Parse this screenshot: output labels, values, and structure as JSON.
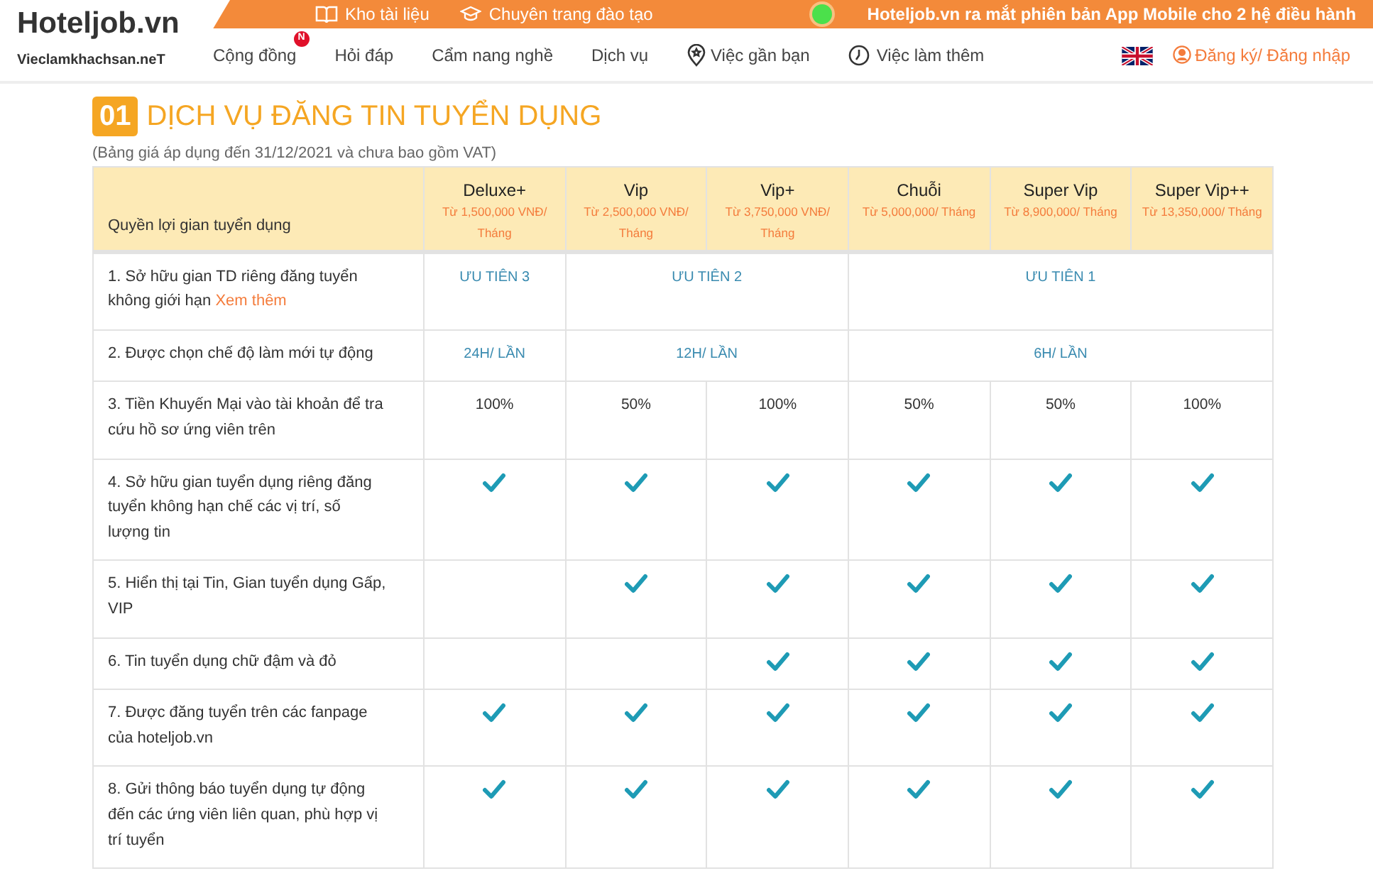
{
  "logo": {
    "name": "Hoteljob.vn",
    "tagline": "Vieclamkhachsan.neT"
  },
  "top_bar": {
    "links": [
      {
        "label": "Kho tài liệu",
        "kind": "book"
      },
      {
        "label": "Chuyên trang đào tạo",
        "kind": "cap"
      }
    ],
    "announcement": "Hoteljob.vn ra mắt phiên bản App Mobile cho 2 hệ điều hành"
  },
  "nav": [
    {
      "label": "Cộng đồng",
      "badge": "N"
    },
    {
      "label": "Hỏi đáp"
    },
    {
      "label": "Cẩm nang nghề"
    },
    {
      "label": "Dịch vụ"
    },
    {
      "label": "Việc gần bạn",
      "kind": "pin"
    },
    {
      "label": "Việc làm thêm",
      "kind": "clock"
    }
  ],
  "account": {
    "label": "Đăng ký/ Đăng nhập"
  },
  "section": {
    "number": "01",
    "title": "DỊCH VỤ ĐĂNG TIN TUYỂN DỤNG",
    "note": "(Bảng giá áp dụng đến 31/12/2021 và chưa bao gồm VAT)"
  },
  "table": {
    "corner": "Quyền lợi gian tuyển dụng",
    "columns": [
      {
        "name": "Deluxe+",
        "price": "Từ 1,500,000 VNĐ/ Tháng"
      },
      {
        "name": "Vip",
        "price": "Từ 2,500,000 VNĐ/ Tháng"
      },
      {
        "name": "Vip+",
        "price": "Từ 3,750,000 VNĐ/ Tháng"
      },
      {
        "name": "Chuỗi",
        "price": "Từ 5,000,000/ Tháng"
      },
      {
        "name": "Super Vip",
        "price": "Từ 8,900,000/ Tháng"
      },
      {
        "name": "Super Vip++",
        "price": "Từ 13,350,000/ Tháng"
      }
    ],
    "rows": [
      {
        "kind": "span",
        "label": "1. Sở hữu gian TD riêng đăng tuyển không giới hạn",
        "link": "Xem thêm",
        "cells": [
          {
            "text": "ƯU TIÊN 3",
            "kind": "single"
          },
          {
            "text": "ƯU TIÊN 2",
            "kind": "pair"
          },
          {
            "text": "ƯU TIÊN 1",
            "kind": "triple"
          }
        ]
      },
      {
        "kind": "span",
        "label": "2. Được chọn chế độ làm mới tự động",
        "cells": [
          {
            "text": "24H/ LẦN",
            "kind": "single"
          },
          {
            "text": "12H/ LẦN",
            "kind": "pair"
          },
          {
            "text": "6H/ LẦN",
            "kind": "triple"
          }
        ]
      },
      {
        "kind": "value",
        "label": "3. Tiền Khuyến Mại vào tài khoản để tra cứu hồ sơ ứng viên trên",
        "values": [
          "100%",
          "50%",
          "100%",
          "50%",
          "50%",
          "100%"
        ]
      },
      {
        "kind": "check",
        "label": "4. Sở hữu gian tuyển dụng riêng đăng tuyển không hạn chế các vị trí, số lượng tin",
        "checked": [
          true,
          true,
          true,
          true,
          true,
          true
        ]
      },
      {
        "kind": "check",
        "label": "5. Hiển thị tại Tin, Gian tuyển dụng Gấp, VIP",
        "checked": [
          false,
          true,
          true,
          true,
          true,
          true
        ]
      },
      {
        "kind": "check",
        "label": "6. Tin tuyển dụng chữ đậm và đỏ",
        "checked": [
          false,
          false,
          true,
          true,
          true,
          true
        ]
      },
      {
        "kind": "check",
        "label": "7. Được đăng tuyển trên các fanpage của hoteljob.vn",
        "checked": [
          true,
          true,
          true,
          true,
          true,
          true
        ]
      },
      {
        "kind": "check",
        "label": "8. Gửi thông báo tuyển dụng tự động đến các ứng viên liên quan, phù hợp vị trí tuyển",
        "checked": [
          true,
          true,
          true,
          true,
          true,
          true
        ]
      }
    ]
  }
}
